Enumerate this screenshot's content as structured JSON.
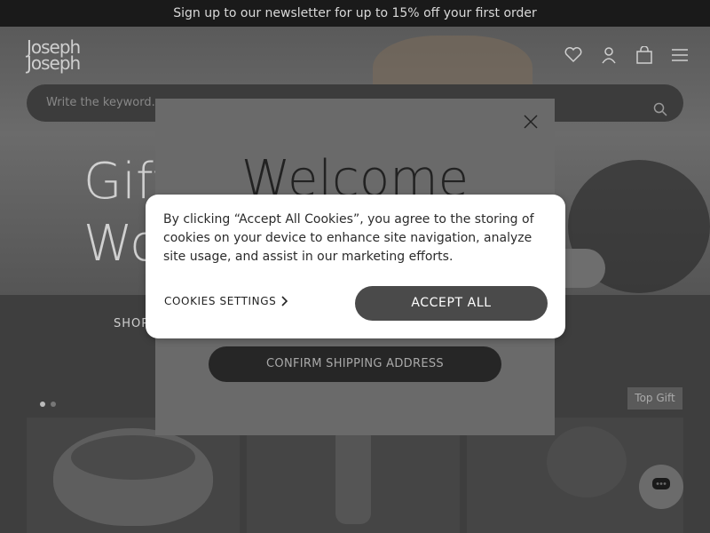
{
  "announcement": {
    "text": "Sign up to our newsletter for up to 15% off your first order"
  },
  "header": {
    "logo_line1": "Joseph",
    "logo_line2": "Joseph",
    "icons": [
      "heart-icon",
      "user-icon",
      "bag-icon",
      "menu-icon"
    ]
  },
  "search": {
    "placeholder": "Write the keyword..."
  },
  "hero": {
    "title_line1": "Gift",
    "title_line2": "Wo"
  },
  "shop": {
    "label": "SHOP"
  },
  "badge": {
    "text": "Top Gift"
  },
  "welcome": {
    "title": "Welcome",
    "close_icon": "close-icon",
    "confirm_label": "CONFIRM SHIPPING ADDRESS"
  },
  "cookie": {
    "message": "By clicking “Accept All Cookies”, you agree to the storing of cookies on your device to enhance site navigation, analyze site usage, and assist in our marketing efforts.",
    "settings_label": "COOKIES SETTINGS",
    "accept_label": "ACCEPT ALL"
  },
  "colors": {
    "accept_button": "#4a4a4a",
    "confirm_button": "#262626",
    "cookie_bg": "#ffffff"
  }
}
